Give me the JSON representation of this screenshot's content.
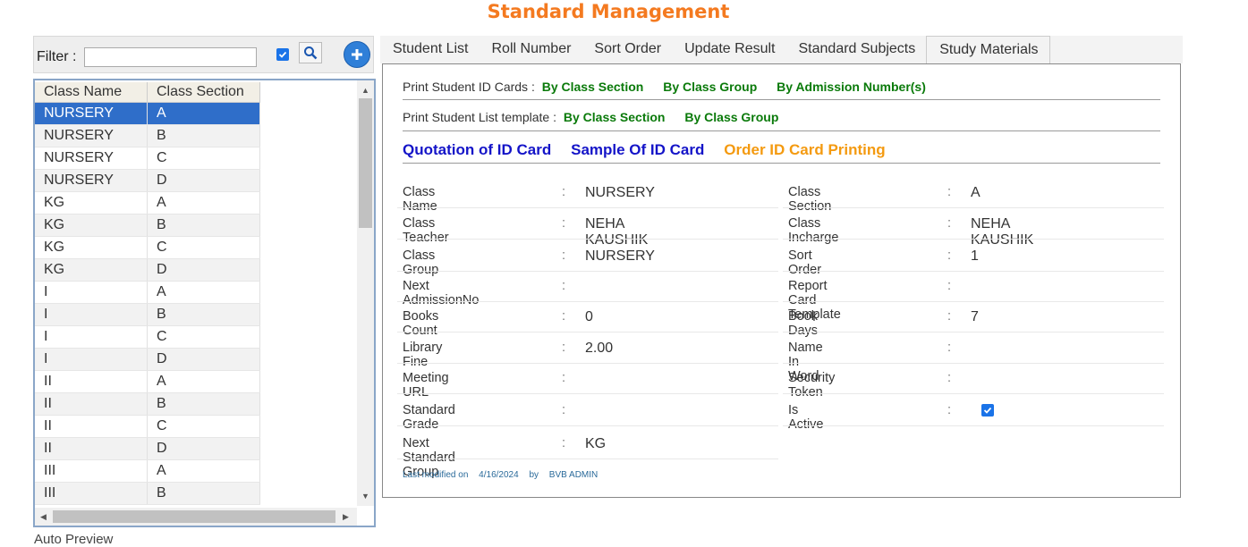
{
  "page_title": "Standard Management",
  "filter": {
    "label": "Filter :",
    "value": ""
  },
  "grid": {
    "headers": [
      "Class Name",
      "Class Section"
    ],
    "rows": [
      [
        "NURSERY",
        "A"
      ],
      [
        "NURSERY",
        "B"
      ],
      [
        "NURSERY",
        "C"
      ],
      [
        "NURSERY",
        "D"
      ],
      [
        "KG",
        "A"
      ],
      [
        "KG",
        "B"
      ],
      [
        "KG",
        "C"
      ],
      [
        "KG",
        "D"
      ],
      [
        "I",
        "A"
      ],
      [
        "I",
        "B"
      ],
      [
        "I",
        "C"
      ],
      [
        "I",
        "D"
      ],
      [
        "II",
        "A"
      ],
      [
        "II",
        "B"
      ],
      [
        "II",
        "C"
      ],
      [
        "II",
        "D"
      ],
      [
        "III",
        "A"
      ],
      [
        "III",
        "B"
      ]
    ],
    "selected_row": 0
  },
  "auto_preview_label": "Auto Preview",
  "tabs": [
    "Student List",
    "Roll Number",
    "Sort Order",
    "Update Result",
    "Standard Subjects",
    "Study Materials"
  ],
  "print_id": {
    "label": "Print Student ID Cards :",
    "links": [
      "By Class Section",
      "By Class Group",
      "By Admission Number(s)"
    ]
  },
  "print_list": {
    "label": "Print Student List template :",
    "links": [
      "By Class Section",
      "By Class Group"
    ]
  },
  "id_links": {
    "quotation": "Quotation of ID Card",
    "sample": "Sample Of ID Card",
    "order": "Order ID Card Printing"
  },
  "details_left": [
    {
      "label": "Class Name",
      "value": "NURSERY"
    },
    {
      "label": "Class Teacher",
      "value": "NEHA KAUSHIK"
    },
    {
      "label": "Class Group",
      "value": "NURSERY"
    },
    {
      "label": "Next AdmissionNo",
      "value": ""
    },
    {
      "label": "Books Count",
      "value": "0"
    },
    {
      "label": "Library Fine",
      "value": "2.00"
    },
    {
      "label": "Meeting URL",
      "value": ""
    },
    {
      "label": "Standard Grade",
      "value": ""
    },
    {
      "label": "Next Standard Group",
      "value": "KG"
    }
  ],
  "details_right": [
    {
      "label": "Class Section",
      "value": "A"
    },
    {
      "label": "Class Incharge",
      "value": "NEHA KAUSHIK"
    },
    {
      "label": "Sort Order",
      "value": "1"
    },
    {
      "label": "Report Card Template",
      "value": ""
    },
    {
      "label": "Book Days",
      "value": "7"
    },
    {
      "label": "Name In Word",
      "value": ""
    },
    {
      "label": "Security Token",
      "value": ""
    },
    {
      "label": "Is Active",
      "value": ""
    }
  ],
  "colon": ":",
  "footer": {
    "prefix": "Last modified on",
    "date": "4/16/2024",
    "by": "by",
    "user": "BVB ADMIN"
  },
  "colors": {
    "title": "#f47a20",
    "selected": "#2f6ec9",
    "green_link": "#0a7a0a",
    "blue_link": "#1414c8",
    "orange_link": "#f49a10"
  }
}
